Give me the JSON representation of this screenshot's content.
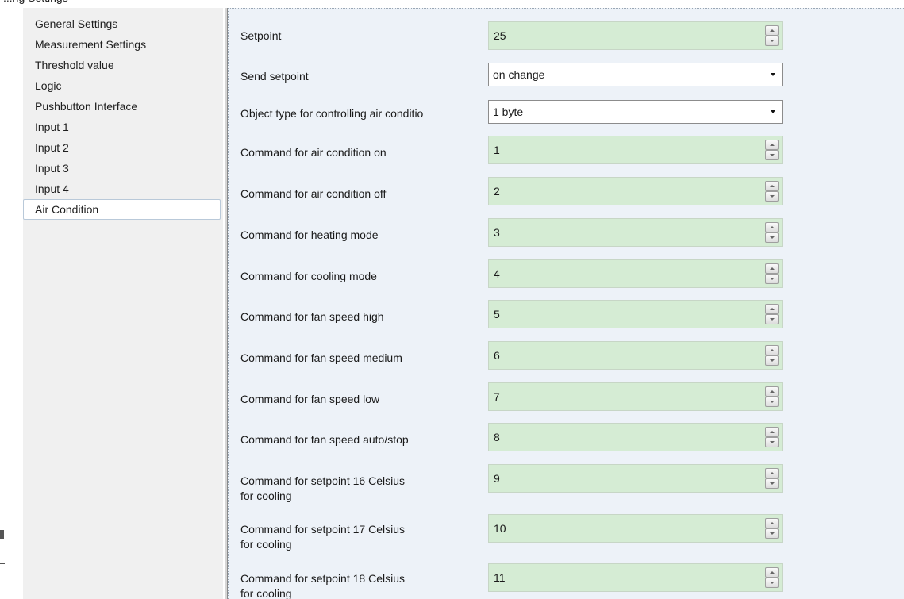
{
  "top_partial_text": "...ng Settings",
  "sidebar": {
    "items": [
      {
        "label": "General Settings",
        "active": false
      },
      {
        "label": "Measurement Settings",
        "active": false
      },
      {
        "label": "Threshold value",
        "active": false
      },
      {
        "label": "Logic",
        "active": false
      },
      {
        "label": "Pushbutton Interface",
        "active": false
      },
      {
        "label": "Input 1",
        "active": false
      },
      {
        "label": "Input 2",
        "active": false
      },
      {
        "label": "Input 3",
        "active": false
      },
      {
        "label": "Input 4",
        "active": false
      },
      {
        "label": "Air Condition",
        "active": true
      }
    ]
  },
  "params": [
    {
      "label": "Setpoint",
      "type": "spin",
      "value": "25"
    },
    {
      "label": "Send setpoint",
      "type": "select",
      "value": "on change"
    },
    {
      "label": "Object type for controlling air conditio",
      "type": "select",
      "value": "1 byte"
    },
    {
      "label": "Command for air condition on",
      "type": "spin",
      "value": "1"
    },
    {
      "label": "Command for air condition off",
      "type": "spin",
      "value": "2"
    },
    {
      "label": "Command for heating mode",
      "type": "spin",
      "value": "3"
    },
    {
      "label": "Command for cooling mode",
      "type": "spin",
      "value": "4"
    },
    {
      "label": "Command for fan speed high",
      "type": "spin",
      "value": "5"
    },
    {
      "label": "Command for fan speed medium",
      "type": "spin",
      "value": "6"
    },
    {
      "label": "Command for fan speed low",
      "type": "spin",
      "value": "7"
    },
    {
      "label": "Command for fan speed auto/stop",
      "type": "spin",
      "value": "8"
    },
    {
      "label": "Command for setpoint 16 Celsius",
      "label2": "for cooling",
      "type": "spin",
      "value": "9"
    },
    {
      "label": "Command for setpoint 17 Celsius",
      "label2": "for cooling",
      "type": "spin",
      "value": "10"
    },
    {
      "label": "Command for setpoint 18 Celsius",
      "label2": "for cooling",
      "type": "spin",
      "value": "11"
    }
  ]
}
